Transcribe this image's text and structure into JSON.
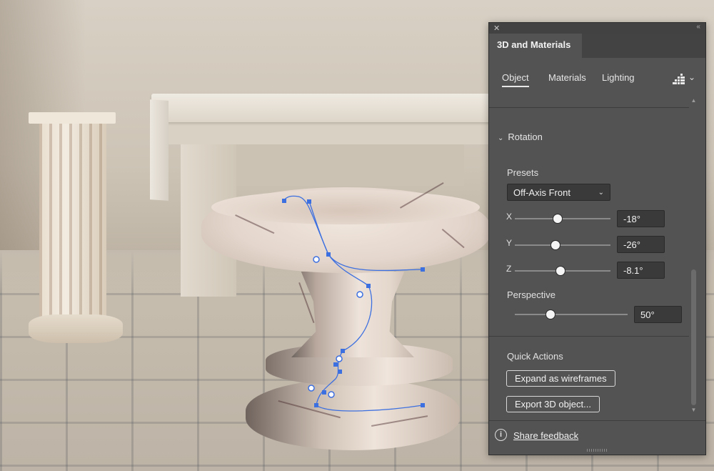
{
  "panel": {
    "title_tab": "3D and Materials",
    "close_glyph": "✕",
    "collapse_glyph": "‹‹",
    "subtabs": [
      {
        "label": "Object",
        "active": true
      },
      {
        "label": "Materials",
        "active": false
      },
      {
        "label": "Lighting",
        "active": false
      }
    ],
    "render_icon": "render-settings-icon",
    "render_chevron": "⌄",
    "rotation": {
      "section_label": "Rotation",
      "presets_label": "Presets",
      "preset_value": "Off-Axis Front",
      "x": {
        "label": "X",
        "value": "-18°",
        "level": -18
      },
      "y": {
        "label": "Y",
        "value": "-26°",
        "level": -26
      },
      "z": {
        "label": "Z",
        "value": "-8.1°",
        "level": -8.1
      },
      "perspective_label": "Perspective",
      "perspective_value": "50°",
      "perspective_level": 50
    },
    "quick_actions": {
      "label": "Quick Actions",
      "expand_button": "Expand as wireframes",
      "export_button": "Export 3D object..."
    },
    "footer": {
      "info_glyph": "i",
      "share_feedback": "Share feedback"
    }
  },
  "colors": {
    "panel_bg": "#535353",
    "panel_dark": "#434343",
    "path_blue": "#3c6fe0"
  }
}
